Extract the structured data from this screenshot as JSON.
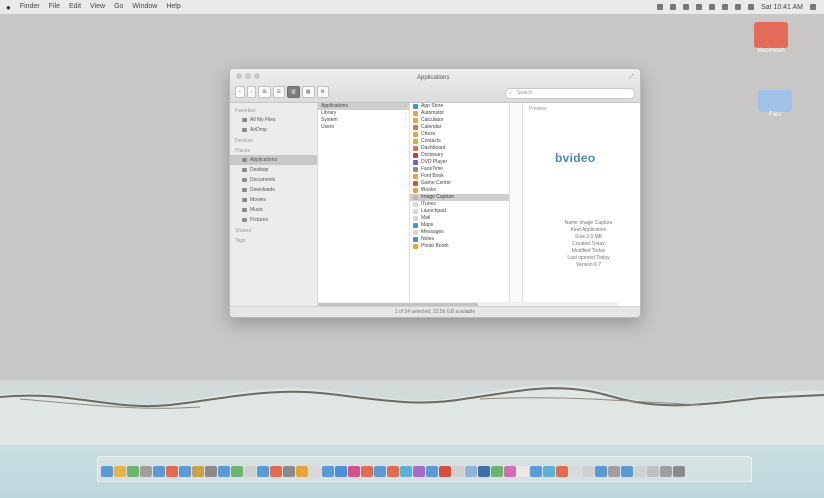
{
  "menubar": {
    "apple": "",
    "items": [
      "Finder",
      "File",
      "Edit",
      "View",
      "Go",
      "Window",
      "Help"
    ],
    "status_icons": [
      "status-icon-1",
      "status-icon-2",
      "status-icon-3",
      "status-icon-4",
      "status-icon-5",
      "status-icon-6",
      "status-icon-7",
      "status-icon-8",
      "status-icon-9",
      "status-icon-10"
    ],
    "clock": "Sat 10:41 AM"
  },
  "desktop": {
    "icons": [
      {
        "label": "Macintosh",
        "color": "#e26b5a"
      },
      {
        "label": "Files",
        "color": "#9fc2e6"
      }
    ]
  },
  "window": {
    "title": "Applications",
    "toolbar": {
      "back": "‹",
      "forward": "›",
      "view_buttons": [
        "⊞",
        "☰",
        "▥",
        "▦"
      ],
      "arrange": "⚙",
      "search_placeholder": "Search"
    },
    "sidebar": {
      "favorites_header": "Favorites",
      "favorites": [
        "All My Files",
        "AirDrop"
      ],
      "devices_header": "Devices",
      "places_header": "Places",
      "places": [
        "Applications",
        "Desktop",
        "Documents",
        "Downloads",
        "Movies",
        "Music",
        "Pictures"
      ],
      "shared_header": "Shared",
      "tags_header": "Tags"
    },
    "column1": [
      {
        "label": "Applications",
        "selected": true,
        "folder": true
      },
      {
        "label": "Library",
        "selected": false,
        "folder": true
      },
      {
        "label": "System",
        "selected": false,
        "folder": true
      },
      {
        "label": "Users",
        "selected": false,
        "folder": true
      }
    ],
    "column2": [
      {
        "label": "App Store",
        "color": "#4a90d9"
      },
      {
        "label": "Automator",
        "color": "#e8a33d"
      },
      {
        "label": "Calculator",
        "color": "#e8a33d"
      },
      {
        "label": "Calendar",
        "color": "#e36b4f"
      },
      {
        "label": "Chess",
        "color": "#e8a33d"
      },
      {
        "label": "Contacts",
        "color": "#e8a33d"
      },
      {
        "label": "Dashboard",
        "color": "#e36b4f"
      },
      {
        "label": "Dictionary",
        "color": "#b6473d"
      },
      {
        "label": "DVD Player",
        "color": "#7a5bb0"
      },
      {
        "label": "FaceTime",
        "color": "#8a8a8a"
      },
      {
        "label": "Font Book",
        "color": "#e8a33d"
      },
      {
        "label": "Game Center",
        "color": "#d94f3d"
      },
      {
        "label": "iBooks",
        "color": "#e8a33d"
      },
      {
        "label": "Image Capture",
        "color": "#bbbbbb",
        "selected": true
      },
      {
        "label": "iTunes",
        "color": "#d8d8d8"
      },
      {
        "label": "Launchpad",
        "color": "#d8d8d8"
      },
      {
        "label": "Mail",
        "color": "#d8d8d8"
      },
      {
        "label": "Maps",
        "color": "#4a90d9"
      },
      {
        "label": "Messages",
        "color": "#d8d8d8"
      },
      {
        "label": "Notes",
        "color": "#4a90d9"
      },
      {
        "label": "Photo Booth",
        "color": "#e8a33d"
      }
    ],
    "preview": {
      "label": "Preview",
      "logo": "bvideo",
      "info": [
        "Name Image Capture",
        "Kind Application",
        "Size 2.3 MB",
        "Created Today",
        "Modified Today",
        "Last opened Today",
        "Version 6.7"
      ]
    },
    "status": "1 of 54 selected, 23.56 GB available"
  },
  "dock": {
    "apps": [
      "#5b9bd5",
      "#e6b34a",
      "#6cb56c",
      "#a0a0a0",
      "#5b9bd5",
      "#e36b4f",
      "#5b9bd5",
      "#c9a24a",
      "#8a8a8a",
      "#5b9bd5",
      "#6cb56c",
      "#d0d0d0",
      "#5b9bd5",
      "#e36b4f",
      "#8a8a8a",
      "#e8a33d",
      "#d9d9d9",
      "#5b9bd5",
      "#4a90d9",
      "#d94f8a",
      "#e36b4f",
      "#5b9bd5",
      "#e36b4f",
      "#5bb0d5",
      "#a56bc9",
      "#5b9bd5",
      "#d94f3d",
      "#d0d0d0",
      "#8fb3d9",
      "#3d6fa8",
      "#6cb56c",
      "#d06fb0",
      "#e8e8e8",
      "#5b9bd5",
      "#5bb0d5",
      "#e36b4f",
      "#d9d9d9",
      "#d0d0d0",
      "#5b9bd5",
      "#a0a0a0",
      "#5b9bd5",
      "#d0d0d0",
      "#c0c0c0",
      "#a0a0a0",
      "#8a8a8a"
    ]
  }
}
